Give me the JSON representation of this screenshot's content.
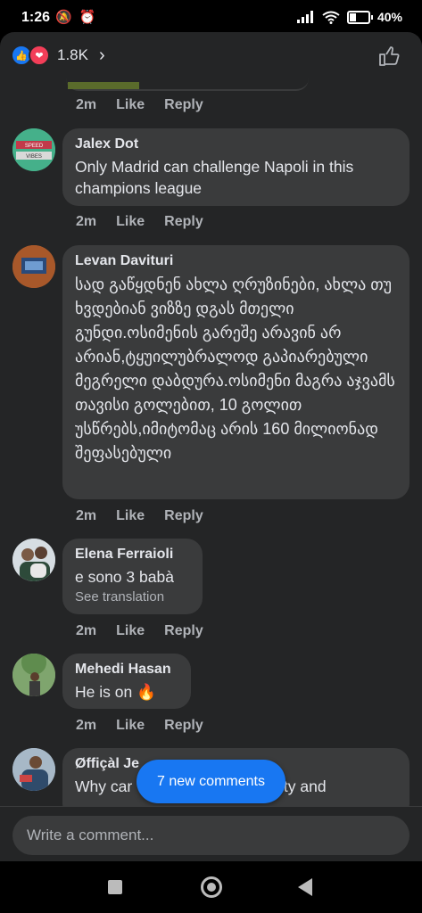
{
  "status_bar": {
    "time": "1:26",
    "battery": "40%",
    "battery_level": 0.4
  },
  "header": {
    "reaction_count": "1.8K"
  },
  "comments": [
    {
      "author": "Jalex Dot",
      "text": "Only Madrid can challenge Napoli in this champions league",
      "time": "2m",
      "like": "Like",
      "reply": "Reply",
      "avatar_text": "SPEED VIBES"
    },
    {
      "author": "Levan Davituri",
      "text": "სად გაწყდნენ ახლა ღრუზინები, ახლა თუ ხვდებიან ვიზზე დგას მთელი გუნდი.ოსიმენის გარეშე არავინ არ არიან,ტყუილუბრალოდ გაპიარებული მეგრელი დაბდურა.ოსიმენი მაგრა აჯვამს თავისი გოლებით, 10 გოლით უსწრებს,იმიტომაც არის 160 მილიონად შეფასებული",
      "time": "2m",
      "like": "Like",
      "reply": "Reply"
    },
    {
      "author": "Elena Ferraioli",
      "text": "e sono 3 babà",
      "see_translation": "See translation",
      "time": "2m",
      "like": "Like",
      "reply": "Reply"
    },
    {
      "author": "Mehedi Hasan",
      "text": "He is on 🔥",
      "time": "2m",
      "like": "Like",
      "reply": "Reply"
    },
    {
      "author": "Øffiçàl Je",
      "text": "Why car",
      "text_right": "lty and"
    }
  ],
  "top_actions": {
    "time": "2m",
    "like": "Like",
    "reply": "Reply"
  },
  "new_comments_pill": "7 new comments",
  "composer": {
    "placeholder": "Write a comment..."
  },
  "colors": {
    "sheet": "#242526",
    "bubble": "#3a3b3c",
    "accent": "#1877f2",
    "muted": "#b0b3b8"
  }
}
